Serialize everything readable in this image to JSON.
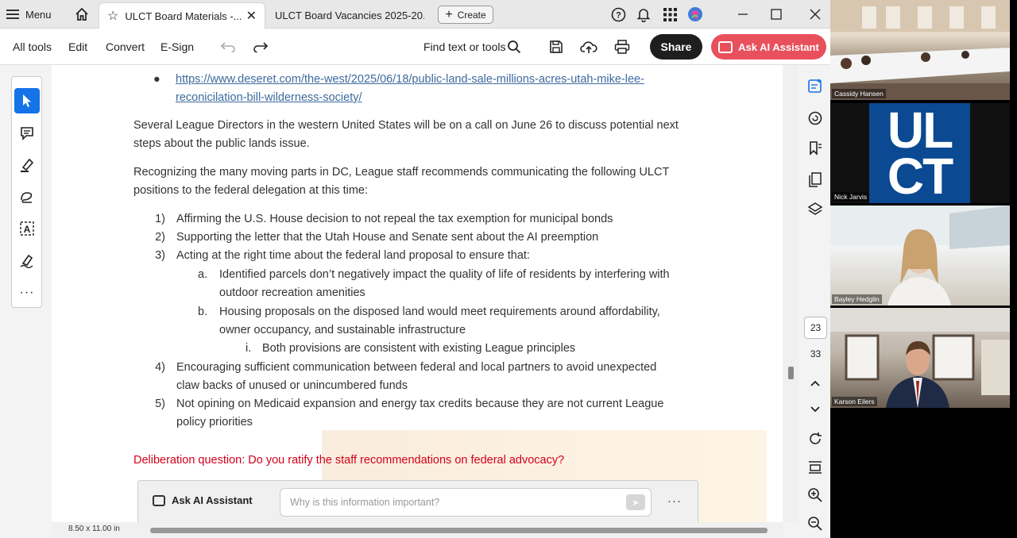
{
  "tabbar": {
    "menu_label": "Menu",
    "tab1_title": "ULCT Board Materials -...",
    "tab2_title": "ULCT Board Vacancies 2025-20...",
    "create_label": "Create"
  },
  "toolbar": {
    "all_tools": "All tools",
    "edit": "Edit",
    "convert": "Convert",
    "esign": "E-Sign",
    "find": "Find text or tools",
    "share": "Share",
    "ask_ai": "Ask AI Assistant"
  },
  "doc": {
    "link_line1": "https://www.deseret.com/the-west/2025/06/18/public-land-sale-millions-acres-utah-mike-lee-",
    "link_line2": "reconicilation-bill-wilderness-society/",
    "para1_l1": "Several League Directors in the western United States will be on a call on June 26 to discuss potential next",
    "para1_l2": "steps about the public lands issue.",
    "para2_l1": "Recognizing the many moving parts in DC, League staff recommends communicating the following ULCT",
    "para2_l2": "positions to the federal delegation at this time:",
    "items": [
      {
        "num": "1)",
        "l1": "Affirming the U.S. House decision to not repeal the tax exemption for municipal bonds"
      },
      {
        "num": "2)",
        "l1": "Supporting the letter that the Utah House and Senate sent about the AI preemption"
      },
      {
        "num": "3)",
        "l1": "Acting at the right time about the federal land proposal to ensure that:"
      },
      {
        "num": "4)",
        "l1": "Encouraging sufficient communication between federal and local partners to avoid unexpected",
        "l2": "claw backs of unused or unincumbered funds"
      },
      {
        "num": "5)",
        "l1": "Not opining on Medicaid expansion and energy tax credits because they are not current League",
        "l2": "policy priorities"
      }
    ],
    "sub_a": {
      "num": "a.",
      "l1": "Identified parcels don’t negatively impact the quality of life of residents by interfering with",
      "l2": "outdoor recreation amenities"
    },
    "sub_b": {
      "num": "b.",
      "l1": "Housing proposals on the disposed land would meet requirements around affordability,",
      "l2": "owner occupancy, and sustainable infrastructure"
    },
    "sub_i": {
      "num": "i.",
      "l1": "Both provisions are consistent with existing League principles"
    },
    "deliberation": "Deliberation question: Do you ratify the staff recommendations on federal advocacy?"
  },
  "ai_bar": {
    "label": "Ask AI Assistant",
    "placeholder": "Why is this information important?"
  },
  "status": {
    "page_size": "8.50 x 11.00 in",
    "page_current": "23",
    "page_total": "33"
  },
  "video": {
    "p1": "Cassidy Hansen",
    "p2": "Nick Jarvis",
    "p3": "Bayley Hedglin",
    "p4": "Karson Eilers",
    "logo_l1": "UL",
    "logo_l2": "CT"
  },
  "colors": {
    "accent": "#1473e6",
    "ai_button": "#e8505b",
    "deliberation": "#d0021b",
    "link": "#3d6a9e",
    "logo_blue": "#0b4a92"
  }
}
